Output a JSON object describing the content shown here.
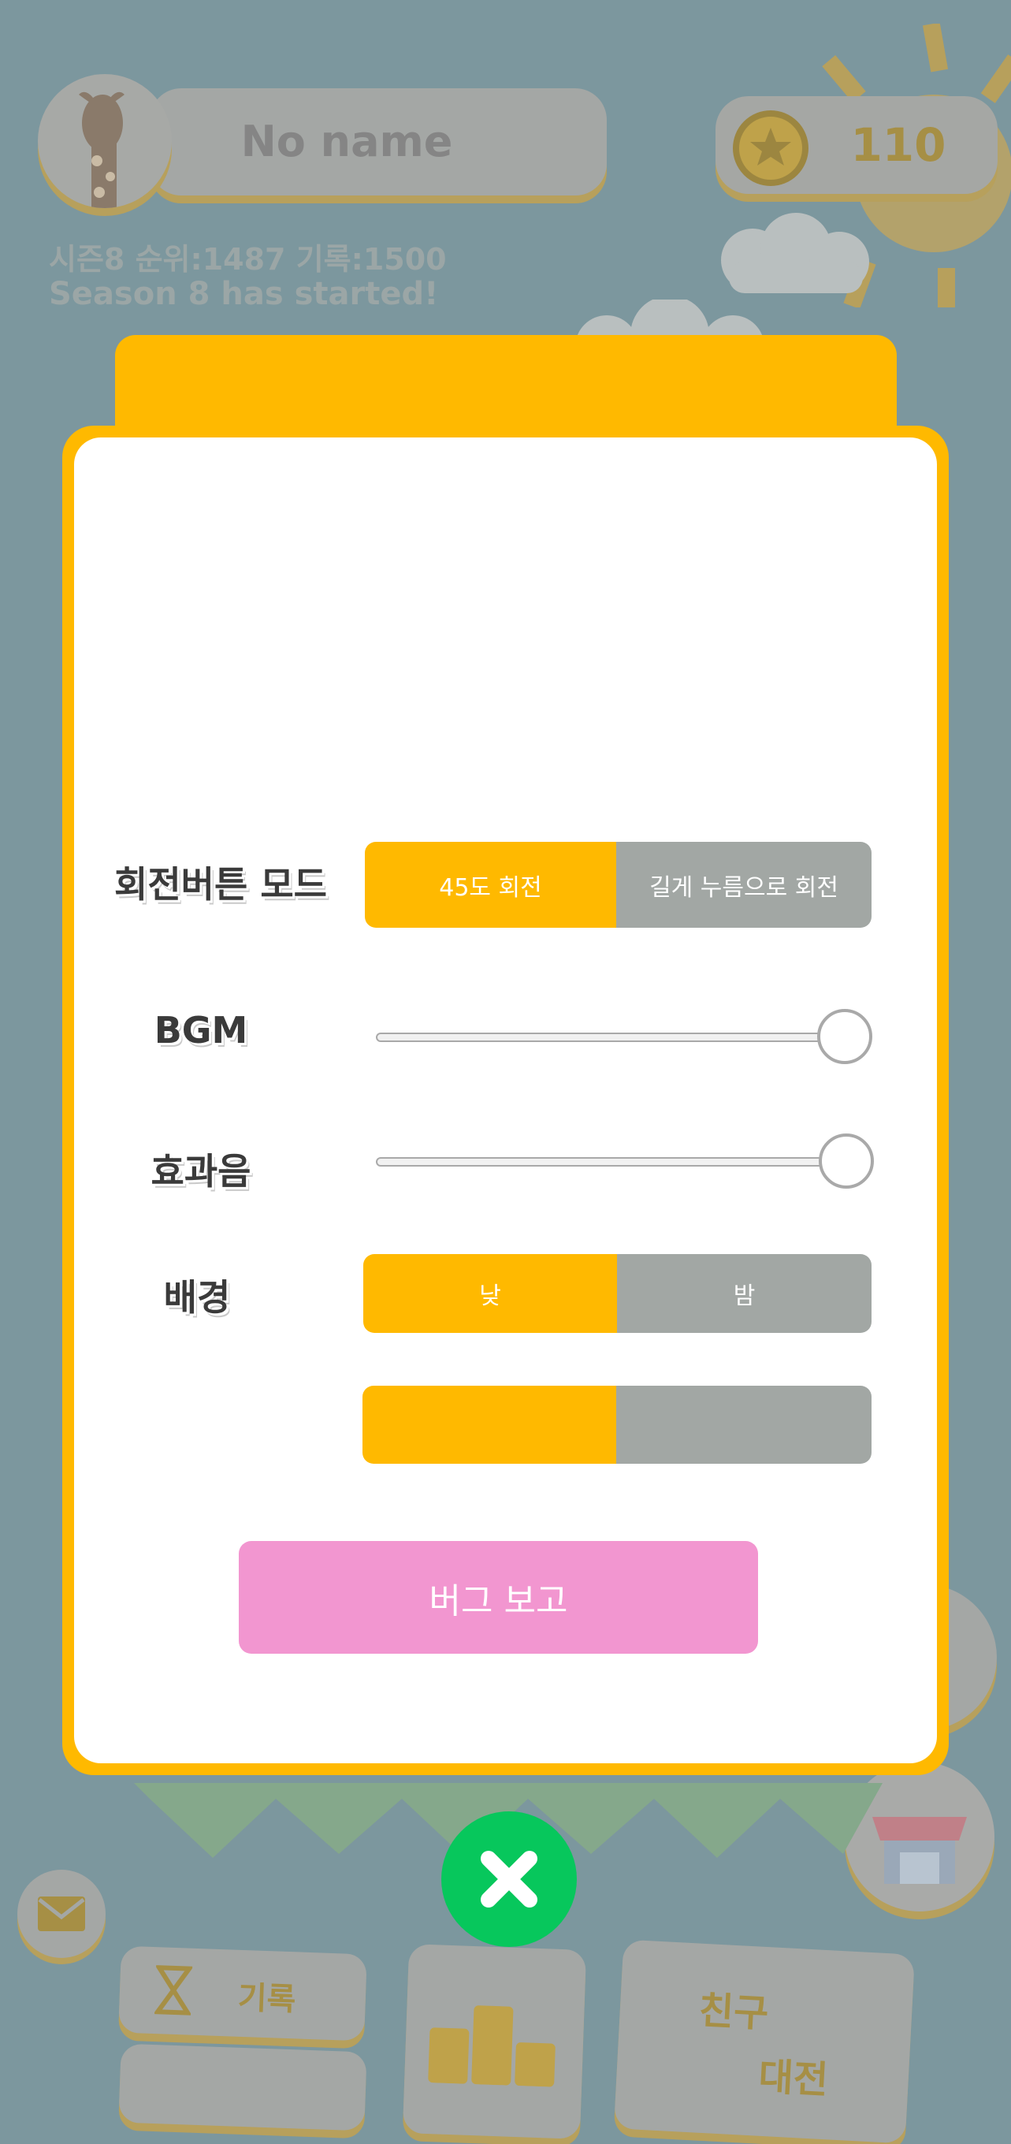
{
  "top_bar": {
    "player_name": "No name",
    "coins": "110",
    "season_line": "시즌8  순위:1487 기록:1500",
    "season_message": "Season 8 has started!"
  },
  "bottom_menu": {
    "record_label": "기록",
    "friend_label": "친구",
    "friend_sub_label": "대전"
  },
  "settings": {
    "rotate_mode": {
      "label": "회전버튼 모드",
      "options": [
        "45도 회전",
        "길게 누름으로 회전"
      ],
      "selected": "45도 회전"
    },
    "bgm": {
      "label": "BGM",
      "level": 1.0
    },
    "sfx": {
      "label": "효과음",
      "level": 1.0
    },
    "background": {
      "label": "배경",
      "options": [
        "낮",
        "밤"
      ],
      "selected": "낮"
    },
    "extra_toggle": {
      "options": [
        "",
        ""
      ],
      "selected_index": 0
    },
    "bug_report_label": "버그 보고"
  },
  "colors": {
    "accent": "#ffb900",
    "inactive": "#a2a7a4",
    "bug_button": "#f296d0",
    "close_button": "#07c75c"
  }
}
